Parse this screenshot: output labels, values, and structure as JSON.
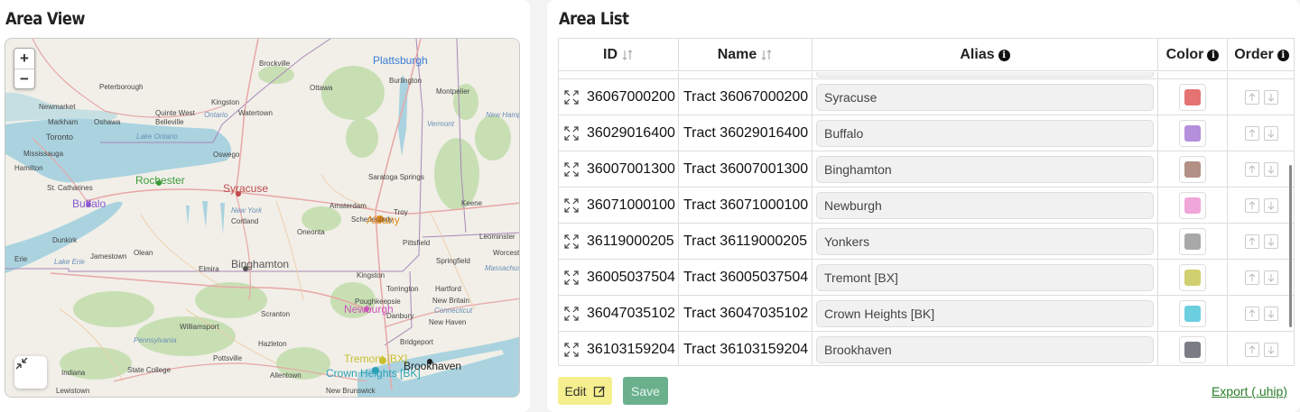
{
  "left_panel": {
    "title": "Area View"
  },
  "map": {
    "zoom_in": "+",
    "zoom_out": "−",
    "highlighted_cities": [
      {
        "label": "Plattsburgh",
        "color": "#3a7bd5"
      },
      {
        "label": "Rochester",
        "color": "#3a9a3a"
      },
      {
        "label": "Syracuse",
        "color": "#c04a4a"
      },
      {
        "label": "Buffalo",
        "color": "#8a5ad0"
      },
      {
        "label": "Albany",
        "color": "#e08a1a"
      },
      {
        "label": "Binghamton",
        "color": "#555555"
      },
      {
        "label": "Newburgh",
        "color": "#cc55bb"
      },
      {
        "label": "Tremont [BX]",
        "color": "#c8c030"
      },
      {
        "label": "Crown Heights [BK]",
        "color": "#2aa0b8"
      },
      {
        "label": "Brookhaven",
        "color": "#222222"
      }
    ],
    "towns": [
      "Brockville",
      "Ottawa",
      "Burlington",
      "Montpelier",
      "Peterborough",
      "Kingston",
      "Watertown",
      "Newmarket",
      "Markham",
      "Oshawa",
      "Quinte West",
      "Belleville",
      "Toronto",
      "Mississauga",
      "Hamilton",
      "St. Catharines",
      "Oswego",
      "Saratoga Springs",
      "Amsterdam",
      "Schenectady",
      "Troy",
      "Cortland",
      "Oneonta",
      "Pittsfield",
      "Keene",
      "Dunkirk",
      "Jamestown",
      "Olean",
      "Elmira",
      "Erie",
      "Leominster",
      "Springfield",
      "Worcester",
      "Kingston",
      "Torrington",
      "Hartford",
      "Poughkeepsie",
      "New Britain",
      "Scranton",
      "Danbury",
      "New Haven",
      "Williamsport",
      "Hazleton",
      "Bridgeport",
      "State College",
      "Pottsville",
      "Allentown",
      "Indiana",
      "Lewistown",
      "New Brunswick"
    ],
    "water_labels": [
      "Lake Ontario",
      "Lake Erie",
      "New York",
      "Vermont",
      "New Hampshire",
      "Pennsylvania",
      "Connecticut",
      "Massachusetts",
      "Ontario"
    ]
  },
  "right_panel": {
    "title": "Area List"
  },
  "table": {
    "headers": {
      "id": "ID",
      "name": "Name",
      "alias": "Alias",
      "color": "Color",
      "order": "Order"
    },
    "rows": [
      {
        "id": "36067000200",
        "name": "Tract 36067000200",
        "alias": "Syracuse",
        "color": "#e57373"
      },
      {
        "id": "36029016400",
        "name": "Tract 36029016400",
        "alias": "Buffalo",
        "color": "#b48fdb"
      },
      {
        "id": "36007001300",
        "name": "Tract 36007001300",
        "alias": "Binghamton",
        "color": "#b29085"
      },
      {
        "id": "36071000100",
        "name": "Tract 36071000100",
        "alias": "Newburgh",
        "color": "#f0a6d8"
      },
      {
        "id": "36119000205",
        "name": "Tract 36119000205",
        "alias": "Yonkers",
        "color": "#a8a8a8"
      },
      {
        "id": "36005037504",
        "name": "Tract 36005037504",
        "alias": "Tremont [BX]",
        "color": "#d0d070"
      },
      {
        "id": "36047035102",
        "name": "Tract 36047035102",
        "alias": "Crown Heights [BK]",
        "color": "#6ccfe0"
      },
      {
        "id": "36103159204",
        "name": "Tract 36103159204",
        "alias": "Brookhaven",
        "color": "#7a7d85"
      }
    ]
  },
  "actions": {
    "edit_label": "Edit",
    "save_label": "Save",
    "export_label": "Export (.uhip)"
  }
}
